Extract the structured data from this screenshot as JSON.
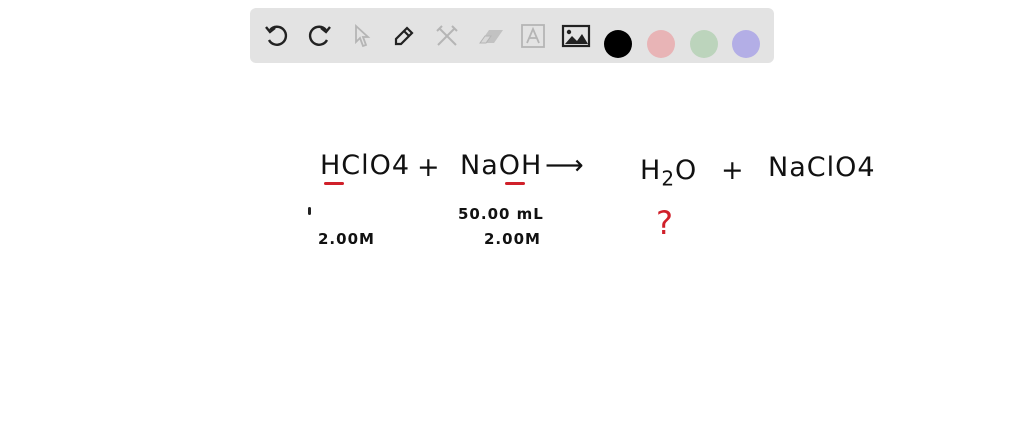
{
  "toolbar": {
    "tools": [
      "undo-icon",
      "redo-icon",
      "select-icon",
      "pen-icon",
      "tools-icon",
      "eraser-icon",
      "text-icon",
      "image-icon"
    ],
    "colors": {
      "black": "#000000",
      "red": "#e8b4b6",
      "green": "#bcd4bc",
      "purple": "#b3aee6"
    }
  },
  "canvas": {
    "reactant1": "HClO4",
    "plus1": "+",
    "reactant2": "NaOH",
    "arrow": "⟶",
    "product1_h": "H",
    "product1_sub": "2",
    "product1_o": "O",
    "plus2": "+",
    "product2": "NaClO4",
    "naoh_volume": "50.00 mL",
    "hclo4_conc": "2.00M",
    "naoh_conc": "2.00M",
    "question": "?"
  }
}
